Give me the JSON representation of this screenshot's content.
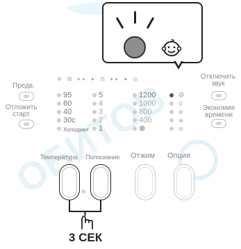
{
  "callout": {
    "led_color": "#8e8e8e",
    "icon": "baby-face-icon"
  },
  "panel": {
    "left_buttons": [
      {
        "label": "Предв."
      },
      {
        "label": "Отложить старт"
      }
    ],
    "right_buttons": [
      {
        "label": "Отключить звук"
      },
      {
        "label": "Экономия времени"
      }
    ],
    "temperature": [
      "95",
      "60",
      "40",
      "30c",
      "Холодная"
    ],
    "rinse": [
      "5",
      "4",
      "3",
      "2",
      "1"
    ],
    "spin": [
      "1200",
      "1000",
      "800",
      "400",
      "⊗"
    ],
    "bottom_labels": {
      "temperature": "Температура",
      "rinse": "Полоскание",
      "spin": "Отжим",
      "option": "Опция"
    }
  },
  "instruction": {
    "hold_time": "3 СЕК"
  },
  "colors": {
    "active_led": "#555555",
    "inactive_led": "#cfcfcf",
    "watermark": "#b9e3f2"
  }
}
